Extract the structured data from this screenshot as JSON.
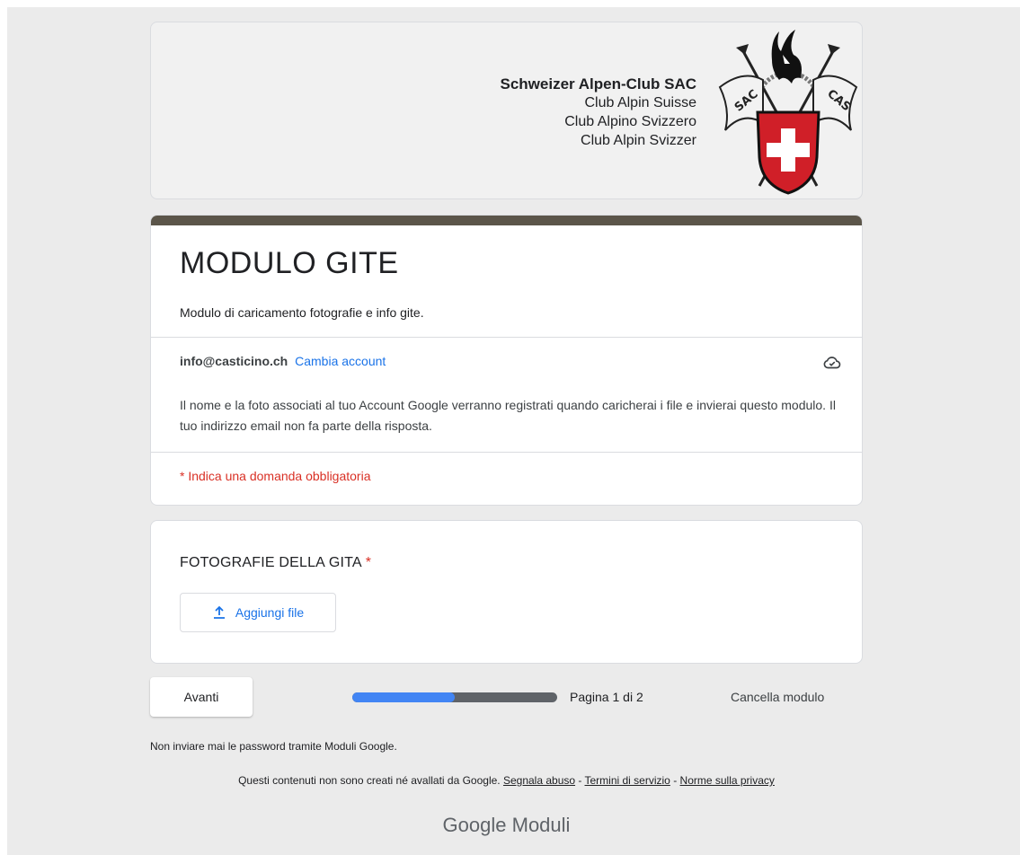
{
  "header": {
    "org_lines": [
      "Schweizer Alpen-Club SAC",
      "Club Alpin Suisse",
      "Club Alpino Svizzero",
      "Club Alpin Svizzer"
    ],
    "logo_text_left": "SAC",
    "logo_text_right": "CAS"
  },
  "form": {
    "title": "MODULO GITE",
    "description": "Modulo di caricamento fotografie e info gite.",
    "account_email": "info@casticino.ch",
    "switch_account": "Cambia account",
    "notice": "Il nome e la foto associati al tuo Account Google verranno registrati quando caricherai i file e invierai questo modulo. Il tuo indirizzo email non fa parte della risposta.",
    "required_note": "* Indica una domanda obbligatoria",
    "accent_color": "#5b5549"
  },
  "question": {
    "title": "FOTOGRAFIE DELLA GITA",
    "required_mark": "*",
    "upload_label": "Aggiungi file"
  },
  "nav": {
    "next_label": "Avanti",
    "progress_fraction": 0.5,
    "page_label": "Pagina 1 di 2",
    "clear_label": "Cancella modulo"
  },
  "footer": {
    "password_warning": "Non inviare mai le password tramite Moduli Google.",
    "disclaimer": "Questi contenuti non sono creati né avallati da Google.",
    "report_abuse": "Segnala abuso",
    "terms": "Termini di servizio",
    "privacy": "Norme sulla privacy",
    "brand_google": "Google",
    "brand_product": "Moduli"
  }
}
